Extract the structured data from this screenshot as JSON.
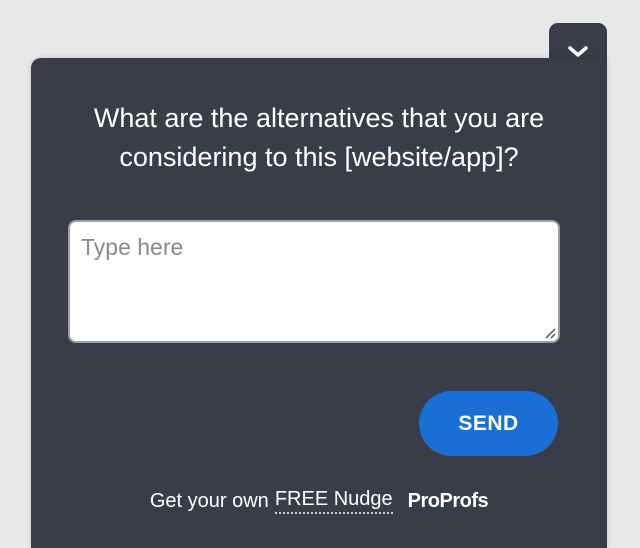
{
  "widget": {
    "question": "What are the alternatives that you are considering to this [website/app]?",
    "answer_placeholder": "Type here",
    "answer_value": "",
    "send_label": "SEND",
    "collapse_icon": "chevron-down-icon"
  },
  "footer": {
    "prefix": "Get your own",
    "link_text": "FREE Nudge",
    "brand": "ProProfs"
  },
  "colors": {
    "panel_bg": "#383d47",
    "page_bg": "#e8e8e8",
    "send_button": "#1a6fd6",
    "text": "#ffffff"
  }
}
